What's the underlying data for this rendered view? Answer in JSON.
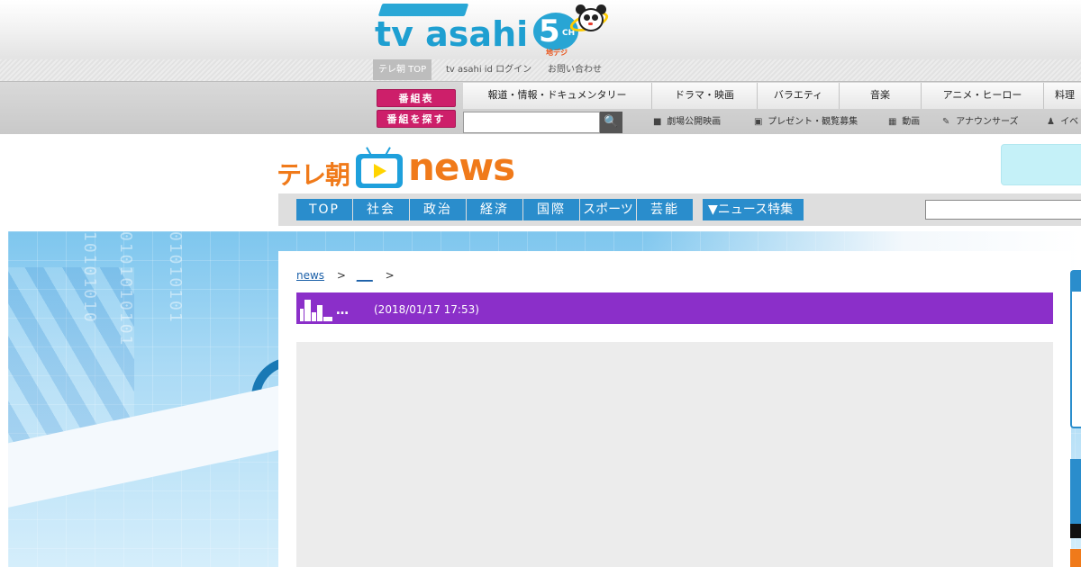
{
  "header": {
    "logo_text": "tv asahi",
    "logo_channel": "5",
    "logo_ch": "CH",
    "logo_sub": "地デジ"
  },
  "utility": {
    "top": "テレ朝 TOP",
    "login": "tv asahi id ログイン",
    "contact": "お問い合わせ"
  },
  "program": {
    "schedule": "番組表",
    "find": "番組を探す",
    "genres": [
      "報道・情報・ドキュメンタリー",
      "ドラマ・映画",
      "バラエティ",
      "音楽",
      "アニメ・ヒーロー",
      "料理"
    ],
    "search_placeholder": "",
    "search_icon": "🔍",
    "sublinks": [
      {
        "icon": "movie-camera-icon",
        "glyph": "🎥",
        "label": "劇場公開映画"
      },
      {
        "icon": "gift-icon",
        "glyph": "🎁",
        "label": "プレゼント・観覧募集"
      },
      {
        "icon": "video-icon",
        "glyph": "▦",
        "label": "動画"
      },
      {
        "icon": "pen-icon",
        "glyph": "✎",
        "label": "アナウンサーズ"
      },
      {
        "icon": "person-icon",
        "glyph": "♟",
        "label": "イベ"
      }
    ]
  },
  "news": {
    "logo_jp": "テレ朝",
    "logo_en": "news",
    "categories": [
      "TOP",
      "社会",
      "政治",
      "経済",
      "国際",
      "スポーツ",
      "芸能"
    ],
    "special": "▼ニュース特集",
    "search_placeholder": ""
  },
  "article": {
    "breadcrumb_home": "news",
    "breadcrumb_sep": ">",
    "breadcrumb_cat": "___",
    "breadcrumb_sep2": ">",
    "title": "…",
    "date": "(2018/01/17 17:53)"
  },
  "colors": {
    "accent_blue": "#2a8dcc",
    "title_purple": "#8b2fc9",
    "brand_orange": "#f07a1a",
    "button_pink": "#cd1f6a"
  }
}
